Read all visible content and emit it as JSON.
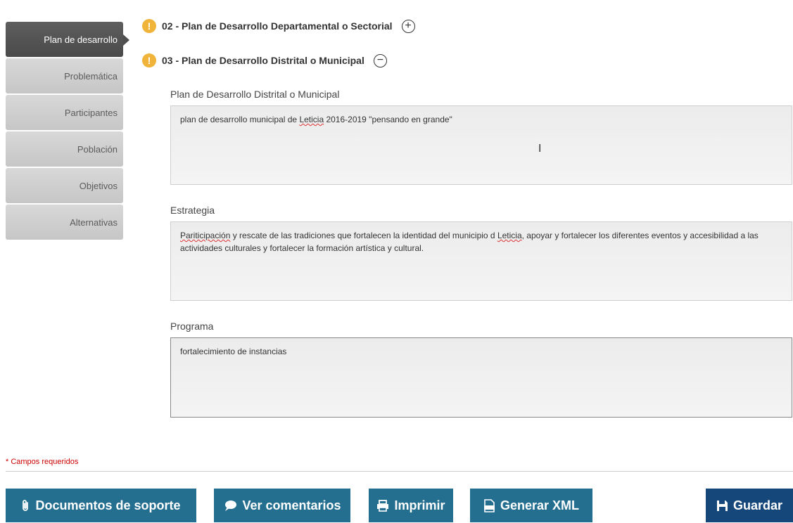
{
  "sidebar": {
    "items": [
      {
        "label": "Plan de desarrollo"
      },
      {
        "label": "Problemática"
      },
      {
        "label": "Participantes"
      },
      {
        "label": "Población"
      },
      {
        "label": "Objetivos"
      },
      {
        "label": "Alternativas"
      }
    ]
  },
  "sections": {
    "s02": {
      "title": "02 - Plan de Desarrollo Departamental o Sectorial",
      "toggle": "+"
    },
    "s03": {
      "title": "03 - Plan de Desarrollo Distrital o Municipal",
      "toggle": "−"
    },
    "warn_glyph": "!"
  },
  "fields": {
    "plan": {
      "label": "Plan de Desarrollo Distrital o Municipal",
      "value_a": "plan de desarrollo municipal de ",
      "value_b": "Leticia",
      "value_c": " 2016-2019 \"pensando en grande\""
    },
    "estrategia": {
      "label": "Estrategia",
      "value_a": "Pariticipación",
      "value_b": " y rescate de las tradiciones que fortalecen la identidad del municipio d ",
      "value_c": "Leticia",
      "value_d": ", apoyar y fortalecer los diferentes eventos y accesibilidad a las actividades culturales y fortalecer la formación artística y cultural."
    },
    "programa": {
      "label": "Programa",
      "value": "fortalecimiento de instancias"
    }
  },
  "footer": {
    "required_note": "* Campos requeridos",
    "buttons": {
      "docs": "Documentos de soporte",
      "comments": "Ver comentarios",
      "print": "Imprimir",
      "xml": "Generar XML",
      "save": "Guardar"
    }
  },
  "colors": {
    "button": "#246e90",
    "save_button": "#16477a",
    "warning": "#f0b43a",
    "sidebar_active": "#4f4f4f"
  },
  "cursor_glyph": "I"
}
